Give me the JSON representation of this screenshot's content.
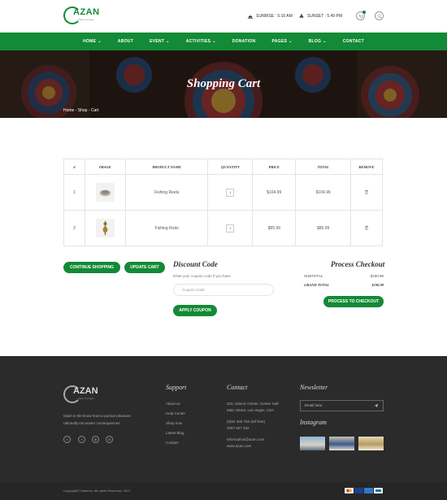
{
  "header": {
    "logo_text": "AZAN",
    "logo_tagline": "place of prayer",
    "sunrise": "SUNRISE : 5.10 AM",
    "sunset": "SUNSET : 5.49 PM"
  },
  "nav": {
    "items": [
      {
        "label": "HOME",
        "has_dropdown": true
      },
      {
        "label": "ABOUT",
        "has_dropdown": false
      },
      {
        "label": "EVENT",
        "has_dropdown": true
      },
      {
        "label": "ACTIVITIES",
        "has_dropdown": true
      },
      {
        "label": "DONATION",
        "has_dropdown": false
      },
      {
        "label": "PAGES",
        "has_dropdown": true
      },
      {
        "label": "BLOG",
        "has_dropdown": true
      },
      {
        "label": "CONTACT",
        "has_dropdown": false
      }
    ]
  },
  "hero": {
    "title": "Shopping Cart",
    "breadcrumb": "Home - Shop - Cart"
  },
  "cart": {
    "headers": [
      "#",
      "IMAGE",
      "PRODUCT NAME",
      "QUANTITY",
      "PRICE",
      "TOTAL",
      "REMOVE"
    ],
    "rows": [
      {
        "num": "1",
        "name": "Fishing Reels",
        "qty": "1",
        "price": "$104.99",
        "total": "$104.99"
      },
      {
        "num": "2",
        "name": "Fishing Rods",
        "qty": "1",
        "price": "$85.99",
        "total": "$85.99"
      }
    ]
  },
  "actions": {
    "continue_label": "CONTINUE SHOPPING",
    "update_label": "UPDATE CART"
  },
  "discount": {
    "title": "Discount Code",
    "note": "Enter your coupon code if you have",
    "placeholder": "Coupon Code",
    "apply_label": "APPLY COUPON"
  },
  "checkout": {
    "title": "Process Checkout",
    "subtotal_label": "SUBTOTAL",
    "subtotal_value": "$190.98",
    "grand_label": "GRAND TOTAL",
    "grand_value": "$190.98",
    "button_label": "PROCESS TO CHECKOUT"
  },
  "footer": {
    "about_line1": "Islam is the know how to pursue pleasure",
    "about_line2": "rationally encounter consequences",
    "social_icons": [
      "facebook-icon",
      "twitter-icon",
      "instagram-icon",
      "google-plus-icon"
    ],
    "support_title": "Support",
    "support_links": [
      "About us",
      "Help Center",
      "Shop now",
      "Latest Blog",
      "Contact"
    ],
    "contact_title": "Contact",
    "contact_address1": "203, Islamic Center, Center Hall",
    "contact_address2": "Main Street, Las Vegas, USA",
    "contact_phone1": "(0)54 365 765 (toll free)",
    "contact_phone2": "0267 567 452",
    "contact_email": "information@azan.com",
    "contact_web": "www.azan.com",
    "newsletter_title": "Newsletter",
    "newsletter_placeholder": "Email here",
    "instagram_title": "Instagram",
    "copyright": "Copyright© Hastech. All rights Reserved. 2017",
    "payment_icons": [
      "mastercard-icon",
      "visa-icon",
      "amex-icon",
      "paypal-icon"
    ]
  },
  "colors": {
    "brand_green": "#138a36",
    "footer_bg": "#2b2b2b"
  }
}
